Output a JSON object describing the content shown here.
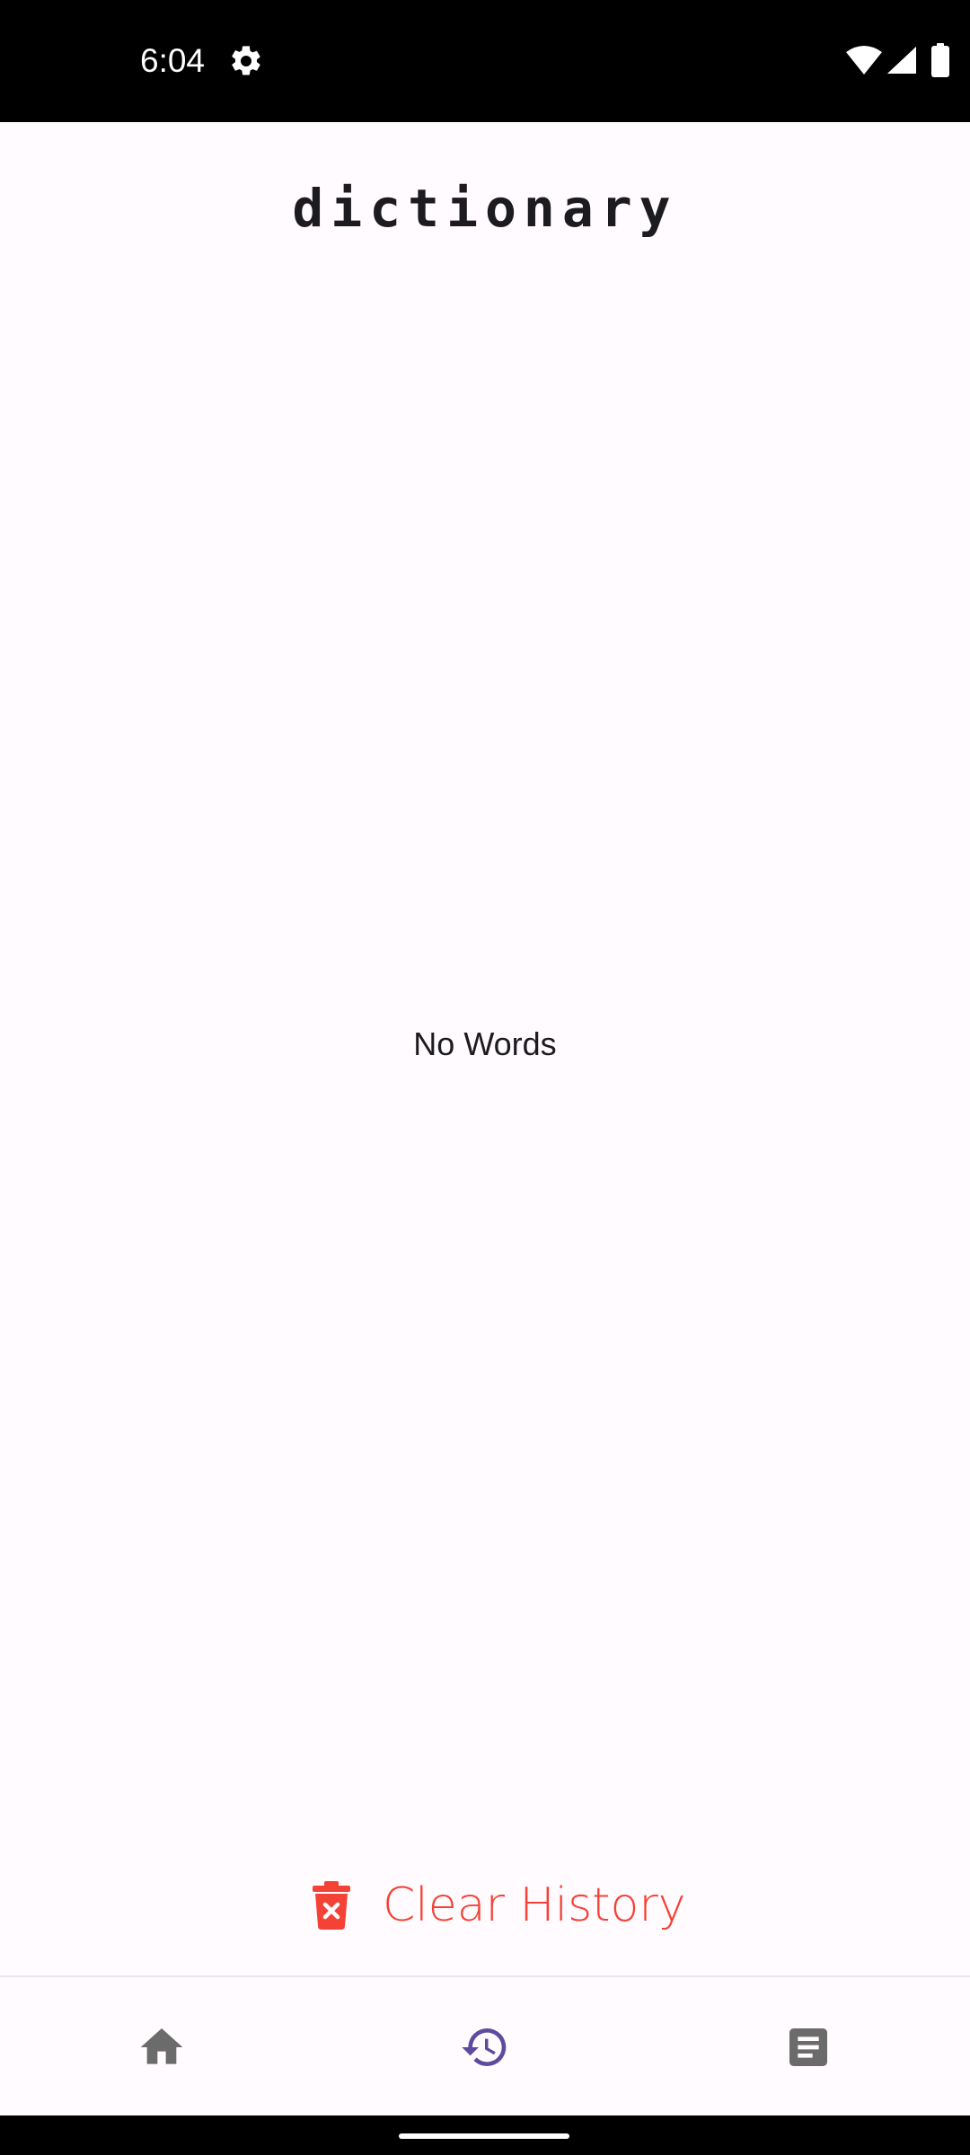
{
  "status_bar": {
    "time": "6:04",
    "icons": [
      "settings-icon",
      "wifi-icon",
      "signal-icon",
      "battery-icon"
    ]
  },
  "header": {
    "title": "dictionary"
  },
  "main": {
    "empty_message": "No Words"
  },
  "actions": {
    "clear_history": {
      "label": "Clear History",
      "icon": "trash-x-icon",
      "color": "#f44336"
    }
  },
  "bottom_nav": {
    "items": [
      {
        "icon": "home-icon",
        "selected": false
      },
      {
        "icon": "history-icon",
        "selected": true
      },
      {
        "icon": "notes-icon",
        "selected": false
      }
    ],
    "active_color": "#5b4c9e",
    "inactive_color": "#6b6b6b"
  },
  "colors": {
    "background": "#fffbfe",
    "text": "#1c1b1f",
    "status_bar": "#000000"
  }
}
